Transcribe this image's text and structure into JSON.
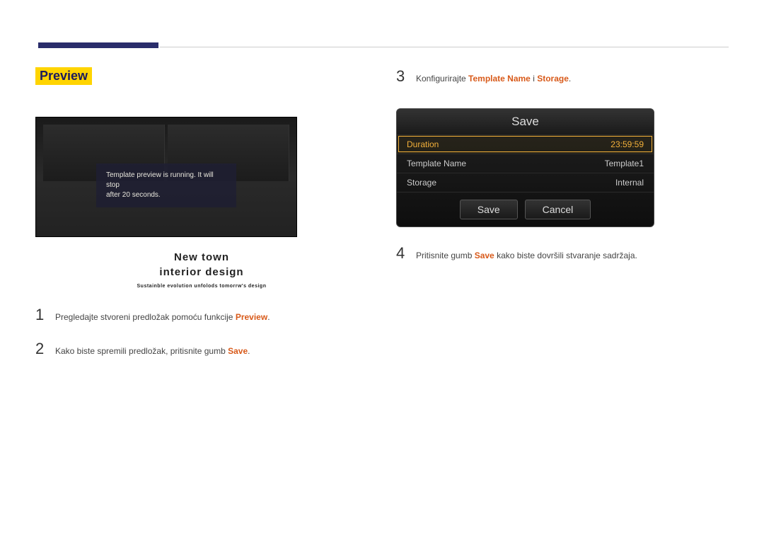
{
  "section_title": "Preview",
  "preview": {
    "msg_line1": "Template preview is running. It will stop",
    "msg_line2": "after 20 seconds.",
    "caption_l1": "New  town",
    "caption_l2": "interior  design",
    "caption_sub": "Sustainble evolution unfolods tomorrw's design"
  },
  "left_steps": [
    {
      "num": "1",
      "pre": "Pregledajte stvoreni predložak pomoću funkcije ",
      "kw": "Preview",
      "post": "."
    },
    {
      "num": "2",
      "pre": "Kako biste spremili predložak, pritisnite gumb ",
      "kw": "Save",
      "post": "."
    }
  ],
  "right_step3": {
    "num": "3",
    "pre": "Konfigurirajte ",
    "kw1": "Template Name",
    "mid": " i ",
    "kw2": "Storage",
    "post": "."
  },
  "right_step4": {
    "num": "4",
    "pre": "Pritisnite gumb ",
    "kw": "Save",
    "post": " kako biste dovršili stvaranje sadržaja."
  },
  "dialog": {
    "title": "Save",
    "rows": [
      {
        "label": "Duration",
        "value": "23:59:59",
        "selected": true
      },
      {
        "label": "Template Name",
        "value": "Template1",
        "selected": false
      },
      {
        "label": "Storage",
        "value": "Internal",
        "selected": false
      }
    ],
    "save_btn": "Save",
    "cancel_btn": "Cancel"
  }
}
